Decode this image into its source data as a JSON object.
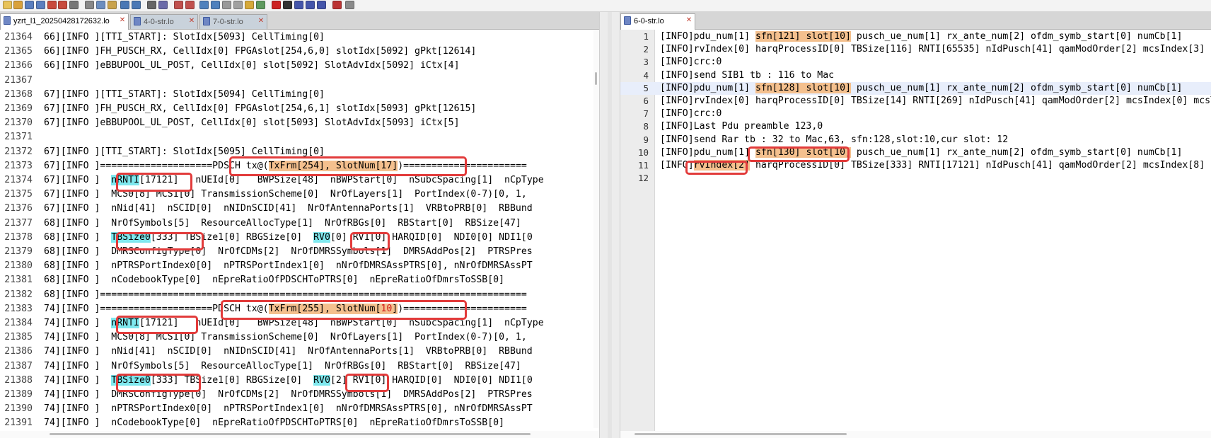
{
  "toolbar": {
    "icons": [
      "new-icon",
      "open-icon",
      "save-icon",
      "save-all-icon",
      "close-icon",
      "close-all-icon",
      "print-icon",
      "cut-icon",
      "copy-icon",
      "paste-icon",
      "undo-icon",
      "redo-icon",
      "find-icon",
      "replace-icon",
      "zoom-in-icon",
      "zoom-out-icon",
      "sync-scroll-icon",
      "wrap-icon",
      "show-all-icon",
      "indent-guide-icon",
      "lang-icon",
      "map-icon",
      "macro-record-icon",
      "macro-stop-icon",
      "macro-play-icon",
      "macro-run-icon",
      "macro-save-icon",
      "spell-check-icon",
      "plugin-icon"
    ]
  },
  "left": {
    "tabs": [
      {
        "label": "yzrt_l1_20250428172632.lo",
        "active": true
      },
      {
        "label": "4-0-str.lo",
        "active": false
      },
      {
        "label": "7-0-str.lo",
        "active": false
      }
    ],
    "lines": [
      {
        "n": "21364",
        "segs": [
          {
            "t": "66][INFO ][TTI_START]: SlotIdx[5093] CellTiming[0]"
          }
        ]
      },
      {
        "n": "21365",
        "segs": [
          {
            "t": "66][INFO ]FH_PUSCH_RX, CellIdx[0] FPGAslot[254,6,0] slotIdx[5092] gPkt[12614]"
          }
        ]
      },
      {
        "n": "21366",
        "segs": [
          {
            "t": "66][INFO ]eBBUPOOL_UL_POST, CellIdx[0] slot[5092] SlotAdvIdx[5092] iCtx[4]"
          }
        ]
      },
      {
        "n": "21367",
        "segs": [
          {
            "t": ""
          }
        ]
      },
      {
        "n": "21368",
        "segs": [
          {
            "t": "67][INFO ][TTI_START]: SlotIdx[5094] CellTiming[0]"
          }
        ]
      },
      {
        "n": "21369",
        "segs": [
          {
            "t": "67][INFO ]FH_PUSCH_RX, CellIdx[0] FPGAslot[254,6,1] slotIdx[5093] gPkt[12615]"
          }
        ]
      },
      {
        "n": "21370",
        "segs": [
          {
            "t": "67][INFO ]eBBUPOOL_UL_POST, CellIdx[0] slot[5093] SlotAdvIdx[5093] iCtx[5]"
          }
        ]
      },
      {
        "n": "21371",
        "segs": [
          {
            "t": ""
          }
        ]
      },
      {
        "n": "21372",
        "segs": [
          {
            "t": "67][INFO ][TTI_START]: SlotIdx[5095] CellTiming[0]"
          }
        ]
      },
      {
        "n": "21373",
        "segs": [
          {
            "t": "67][INFO ]====================PDSCH tx@("
          },
          {
            "t": "TxFrm[254], SlotNum[17]",
            "c": "hl-orange"
          },
          {
            "t": ")======================"
          }
        ]
      },
      {
        "n": "21374",
        "segs": [
          {
            "t": "67][INFO ]  "
          },
          {
            "t": "nRNTI",
            "c": "hl-cyan"
          },
          {
            "t": "[17121]   nUEId[0]   BWPSize[48]  nBWPStart[0]  nSubcSpacing[1]  nCpType"
          }
        ]
      },
      {
        "n": "21375",
        "segs": [
          {
            "t": "67][INFO ]  MCS0[8] MCS1[0] TransmissionScheme[0]  NrOfLayers[1]  PortIndex(0-7)[0, 1,"
          }
        ]
      },
      {
        "n": "21376",
        "segs": [
          {
            "t": "67][INFO ]  nNid[41]  nSCID[0]  nNIDnSCID[41]  NrOfAntennaPorts[1]  VRBtoPRB[0]  RBBund"
          }
        ]
      },
      {
        "n": "21377",
        "segs": [
          {
            "t": "68][INFO ]  NrOfSymbols[5]  ResourceAllocType[1]  NrOfRBGs[0]  RBStart[0]  RBSize[47]"
          }
        ]
      },
      {
        "n": "21378",
        "segs": [
          {
            "t": "68][INFO ]  "
          },
          {
            "t": "TBSize0",
            "c": "hl-cyan"
          },
          {
            "t": "[333] TBSize1[0] RBGSize[0]  "
          },
          {
            "t": "RV0",
            "c": "hl-cyan"
          },
          {
            "t": "[0] RV1[0] HARQID[0]  NDI0[0] NDI1[0"
          }
        ]
      },
      {
        "n": "21379",
        "segs": [
          {
            "t": "68][INFO ]  DMRSConfigType[0]  NrOfCDMs[2]  NrOfDMRSSymbols[1]  DMRSAddPos[2]  PTRSPres"
          }
        ]
      },
      {
        "n": "21380",
        "segs": [
          {
            "t": "68][INFO ]  nPTRSPortIndex0[0]  nPTRSPortIndex1[0]  nNrOfDMRSAssPTRS[0], nNrOfDMRSAssPT"
          }
        ]
      },
      {
        "n": "21381",
        "segs": [
          {
            "t": "68][INFO ]  nCodebookType[0]  nEpreRatioOfPDSCHToPTRS[0]  nEpreRatioOfDmrsToSSB[0]"
          }
        ]
      },
      {
        "n": "21382",
        "segs": [
          {
            "t": "68][INFO ]============================================================================"
          }
        ]
      },
      {
        "n": "21383",
        "segs": [
          {
            "t": "74][INFO ]====================PDSCH tx@("
          },
          {
            "t": "TxFrm[255], SlotNum[",
            "c": "hl-orange"
          },
          {
            "t": "10",
            "c": "hl-red"
          },
          {
            "t": "]",
            "c": "hl-orange"
          },
          {
            "t": ")======================"
          }
        ]
      },
      {
        "n": "21384",
        "segs": [
          {
            "t": "74][INFO ]  "
          },
          {
            "t": "nRNTI",
            "c": "hl-cyan"
          },
          {
            "t": "[17121]   nUEId[0]   BWPSize[48]  nBWPStart[0]  nSubcSpacing[1]  nCpType"
          }
        ]
      },
      {
        "n": "21385",
        "segs": [
          {
            "t": "74][INFO ]  MCS0[8] MCS1[0] TransmissionScheme[0]  NrOfLayers[1]  PortIndex(0-7)[0, 1,"
          }
        ]
      },
      {
        "n": "21386",
        "segs": [
          {
            "t": "74][INFO ]  nNid[41]  nSCID[0]  nNIDnSCID[41]  NrOfAntennaPorts[1]  VRBtoPRB[0]  RBBund"
          }
        ]
      },
      {
        "n": "21387",
        "segs": [
          {
            "t": "74][INFO ]  NrOfSymbols[5]  ResourceAllocType[1]  NrOfRBGs[0]  RBStart[0]  RBSize[47]"
          }
        ]
      },
      {
        "n": "21388",
        "segs": [
          {
            "t": "74][INFO ]  "
          },
          {
            "t": "TBSize0",
            "c": "hl-cyan"
          },
          {
            "t": "[333] TBSize1[0] RBGSize[0]  "
          },
          {
            "t": "RV0",
            "c": "hl-cyan"
          },
          {
            "t": "[2] RV1[0] HARQID[0]  NDI0[0] NDI1[0"
          }
        ]
      },
      {
        "n": "21389",
        "segs": [
          {
            "t": "74][INFO ]  DMRSConfigType[0]  NrOfCDMs[2]  NrOfDMRSSymbols[1]  DMRSAddPos[2]  PTRSPres"
          }
        ]
      },
      {
        "n": "21390",
        "segs": [
          {
            "t": "74][INFO ]  nPTRSPortIndex0[0]  nPTRSPortIndex1[0]  nNrOfDMRSAssPTRS[0], nNrOfDMRSAssPT"
          }
        ]
      },
      {
        "n": "21391",
        "segs": [
          {
            "t": "74][INFO ]  nCodebookType[0]  nEpreRatioOfPDSCHToPTRS[0]  nEpreRatioOfDmrsToSSB[0]"
          }
        ]
      }
    ]
  },
  "right": {
    "tabs": [
      {
        "label": "6-0-str.lo",
        "active": true
      }
    ],
    "lines": [
      {
        "n": "1",
        "segs": [
          {
            "t": "[INFO]pdu_num[1] "
          },
          {
            "t": "sfn[121] slot[10]",
            "c": "hl-orange"
          },
          {
            "t": " pusch_ue_num[1] rx_ante_num[2] ofdm_symb_start[0] numCb[1]"
          }
        ]
      },
      {
        "n": "2",
        "segs": [
          {
            "t": "[INFO]rvIndex[0] harqProcessID[0] TBSize[116] RNTI[65535] nIdPusch[41] qamModOrder[2] mcsIndex[3] n"
          }
        ]
      },
      {
        "n": "3",
        "segs": [
          {
            "t": "[INFO]crc:0"
          }
        ]
      },
      {
        "n": "4",
        "segs": [
          {
            "t": "[INFO]send SIB1 tb : 116 to Mac"
          }
        ]
      },
      {
        "n": "5",
        "segs": [
          {
            "t": "[INFO]pdu_num[1] "
          },
          {
            "t": "sfn[128] slot[10]",
            "c": "hl-orange"
          },
          {
            "t": " pusch_ue_num[1] rx_ante_num[2] ofdm_symb_start[0] numCb[1]"
          }
        ],
        "current": true
      },
      {
        "n": "6",
        "segs": [
          {
            "t": "[INFO]rvIndex[0] harqProcessID[0] TBSize[14] RNTI[269] nIdPusch[41] qamModOrder[2] mcsIndex[0] mcsT"
          }
        ]
      },
      {
        "n": "7",
        "segs": [
          {
            "t": "[INFO]crc:0"
          }
        ]
      },
      {
        "n": "8",
        "segs": [
          {
            "t": "[INFO]Last Pdu preamble 123,0"
          }
        ]
      },
      {
        "n": "9",
        "segs": [
          {
            "t": "[INFO]send Rar tb : 32 to Mac,63, sfn:128,slot:10,cur slot: 12"
          }
        ]
      },
      {
        "n": "10",
        "segs": [
          {
            "t": "[INFO]pdu_num[1] "
          },
          {
            "t": "sfn[130] slot[10]",
            "c": "hl-orange"
          },
          {
            "t": " pusch_ue_num[1] rx_ante_num[2] ofdm_symb_start[0] numCb[1]"
          }
        ]
      },
      {
        "n": "11",
        "segs": [
          {
            "t": "[INFO]"
          },
          {
            "t": "rvIndex[2]",
            "c": "hl-orange"
          },
          {
            "t": " harqProcessID[0] TBSize[333] RNTI[17121] nIdPusch[41] qamModOrder[2] mcsIndex[8] n"
          }
        ]
      },
      {
        "n": "12",
        "segs": [
          {
            "t": ""
          }
        ]
      }
    ]
  }
}
